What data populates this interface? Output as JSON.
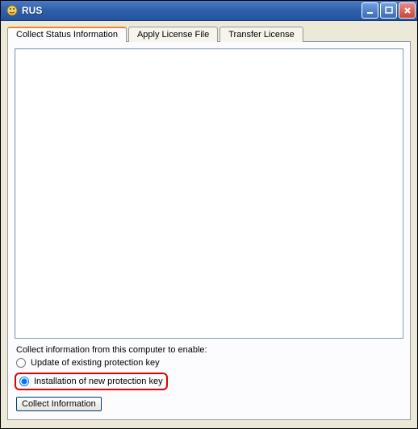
{
  "window": {
    "title": "RUS"
  },
  "tabs": [
    {
      "label": "Collect Status Information",
      "active": true
    },
    {
      "label": "Apply License File",
      "active": false
    },
    {
      "label": "Transfer License",
      "active": false
    }
  ],
  "panel": {
    "prompt": "Collect information from this computer to enable:",
    "options": {
      "update": "Update of existing protection key",
      "install": "Installation of new protection key"
    },
    "selected": "install",
    "button": "Collect Information"
  }
}
